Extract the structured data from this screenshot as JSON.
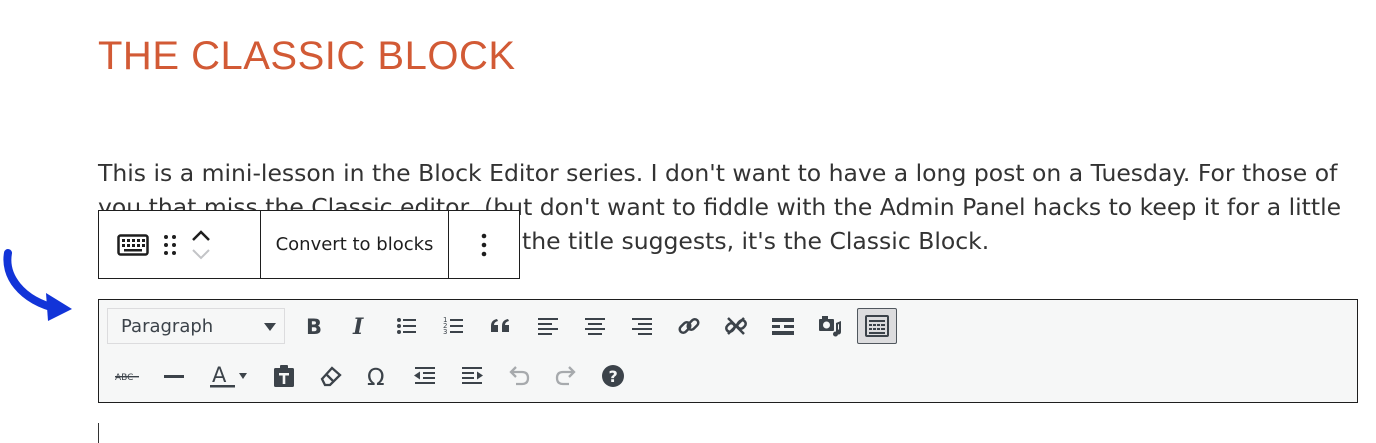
{
  "post": {
    "title": "THE CLASSIC BLOCK",
    "intro_line1": "This is a mini-lesson in the Block Editor series. I don't want to have a long post on a Tuesday. For those of",
    "intro_line2": "you that miss the Classic editor, (but don't want to fiddle with the Admin Panel hacks to keep it for a little",
    "intro_line3": "the title suggests, it's the Classic Block."
  },
  "block_toolbar": {
    "convert_label": "Convert to blocks",
    "icons": [
      "keyboard-icon",
      "drag-handle-icon",
      "move-up-icon",
      "move-down-icon",
      "more-options-icon"
    ]
  },
  "classic_toolbar": {
    "format_select": "Paragraph",
    "row1": [
      "bold",
      "italic",
      "bulleted-list",
      "numbered-list",
      "blockquote",
      "align-left",
      "align-center",
      "align-right",
      "insert-link",
      "remove-link",
      "read-more",
      "add-media",
      "toolbar-toggle"
    ],
    "row2": [
      "strikethrough",
      "horizontal-line",
      "text-color",
      "paste-as-text",
      "clear-formatting",
      "special-character",
      "decrease-indent",
      "increase-indent",
      "undo",
      "redo",
      "keyboard-shortcuts"
    ],
    "text_color_letter": "A",
    "strike_label": "ABC",
    "omega_label": "Ω",
    "help_label": "?"
  },
  "colors": {
    "title": "#d25a35",
    "annotation_arrow": "#1234d8",
    "text": "#333333",
    "border": "#1e1e1e"
  }
}
